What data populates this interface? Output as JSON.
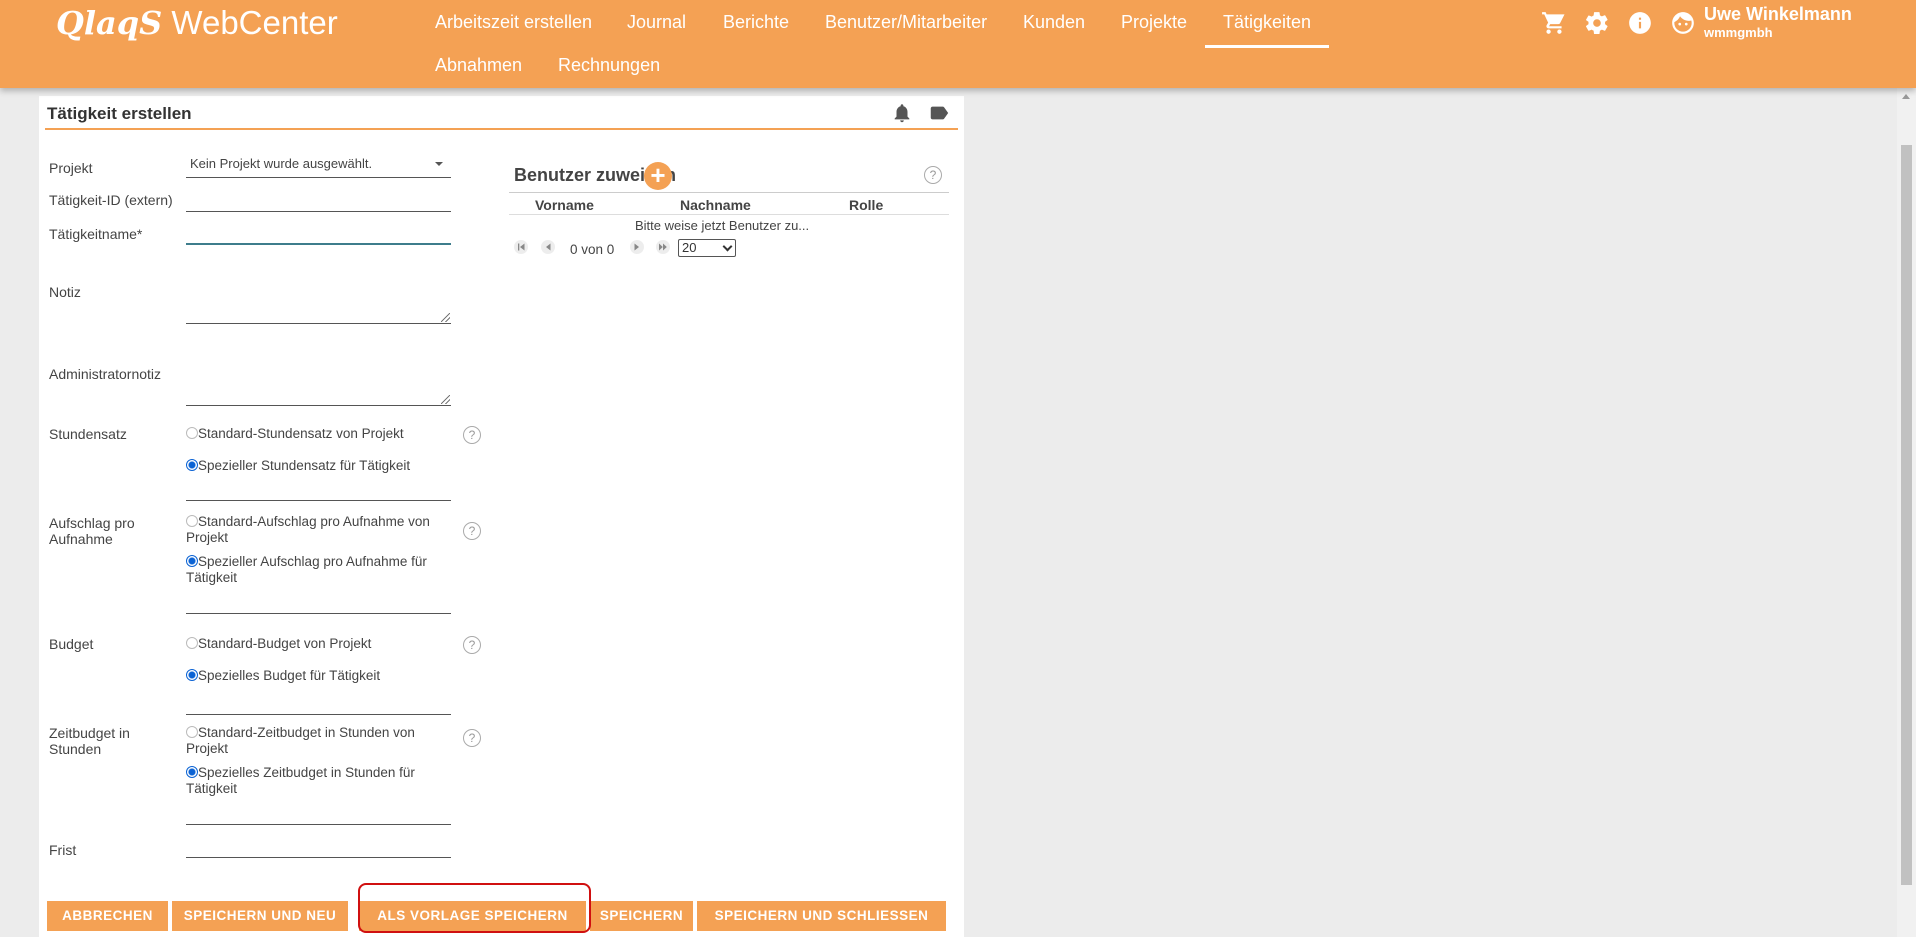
{
  "header": {
    "logo_bold": "QlaqS",
    "logo_rest": " WebCenter",
    "nav": [
      {
        "label": "Arbeitszeit erstellen"
      },
      {
        "label": "Journal"
      },
      {
        "label": "Berichte"
      },
      {
        "label": "Benutzer/Mitarbeiter"
      },
      {
        "label": "Kunden"
      },
      {
        "label": "Projekte"
      },
      {
        "label": "Tätigkeiten",
        "active": true
      },
      {
        "label": "Abnahmen"
      },
      {
        "label": "Rechnungen"
      }
    ],
    "icons": [
      "cart-icon",
      "gear-icon",
      "info-icon",
      "user-face-icon"
    ],
    "user_name": "Uwe Winkelmann",
    "user_company": "wmmgmbh",
    "accent": "#f4a154"
  },
  "card": {
    "title": "Tätigkeit erstellen",
    "icons": [
      "bell-icon",
      "tag-icon"
    ]
  },
  "form": {
    "projekt_label": "Projekt",
    "projekt_value": "Kein Projekt wurde ausgewählt.",
    "taetigkeit_id_label": "Tätigkeit-ID (extern)",
    "taetigkeit_id_value": "",
    "taetigkeitname_label": "Tätigkeitname*",
    "taetigkeitname_value": "",
    "notiz_label": "Notiz",
    "admin_notiz_label": "Administratornotiz",
    "stundensatz": {
      "label": "Stundensatz",
      "opt1": "Standard-Stundensatz von Projekt",
      "opt2": "Spezieller Stundensatz für Tätigkeit",
      "selected": 2
    },
    "aufschlag": {
      "label": "Aufschlag pro Aufnahme",
      "opt1": "Standard-Aufschlag pro Aufnahme von Projekt",
      "opt2": "Spezieller Aufschlag pro Aufnahme für Tätigkeit",
      "selected": 2
    },
    "budget": {
      "label": "Budget",
      "opt1": "Standard-Budget von Projekt",
      "opt2": "Spezielles Budget für Tätigkeit",
      "selected": 2
    },
    "zeitbudget": {
      "label": "Zeitbudget in Stunden",
      "opt1": "Standard-Zeitbudget in Stunden von Projekt",
      "opt2": "Spezielles Zeitbudget in Stunden für Tätigkeit",
      "selected": 2
    },
    "frist_label": "Frist",
    "help_glyph": "?"
  },
  "assign": {
    "title": "Benutzer zuweisen",
    "add_glyph": "+",
    "columns": [
      "Vorname",
      "Nachname",
      "Rolle"
    ],
    "empty_message": "Bitte weise jetzt Benutzer zu...",
    "pager_text": "0 von 0",
    "page_size": "20"
  },
  "buttons": {
    "cancel": "ABBRECHEN",
    "save_new": "SPEICHERN UND NEU",
    "save_template": "ALS VORLAGE SPEICHERN",
    "save": "SPEICHERN",
    "save_close": "SPEICHERN UND SCHLIESSEN"
  }
}
